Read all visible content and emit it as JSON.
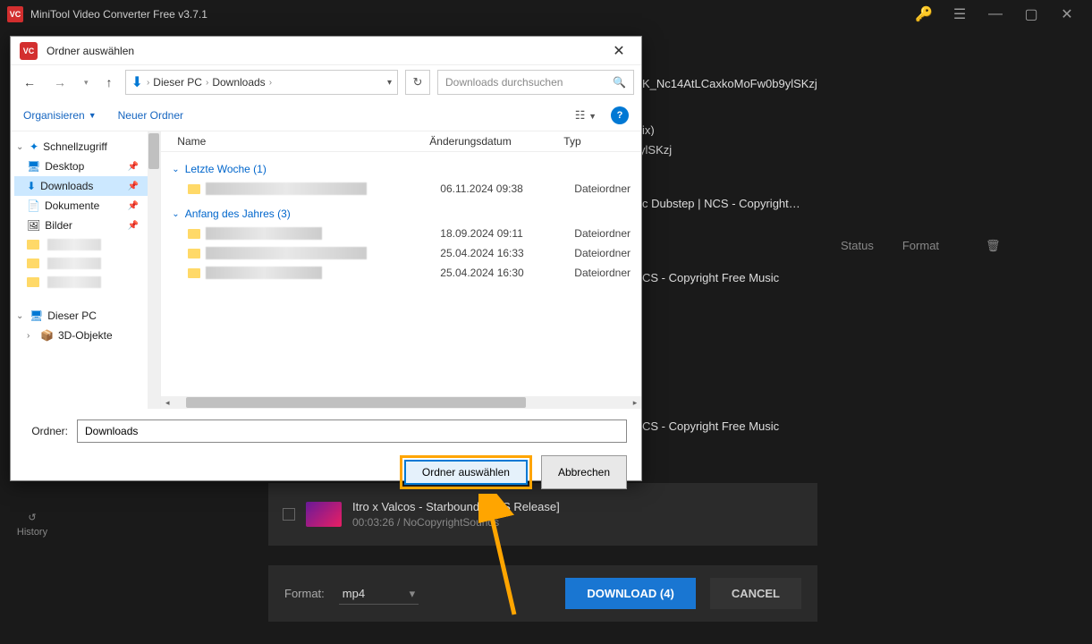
{
  "app": {
    "title": "MiniTool Video Converter Free v3.7.1",
    "logo_text": "VC"
  },
  "history_label": "History",
  "url_display": "Fw0b9ylSKzj",
  "url_truncated": "K_Nc14AtLCaxkoMoFw0b9ylSKzj",
  "playlist_frag": "ix)",
  "videos": [
    {
      "title_frag": "c Dubstep | NCS - Copyright…"
    },
    {
      "title_frag": "CS - Copyright Free Music"
    },
    {
      "title_frag": "CS - Copyright Free Music"
    },
    {
      "title": "Itro x Valcos - Starbound [NCS Release]",
      "meta": "00:03:26 / NoCopyrightSounds"
    }
  ],
  "headers": {
    "status": "Status",
    "format": "Format"
  },
  "format": {
    "label": "Format:",
    "value": "mp4"
  },
  "buttons": {
    "download": "DOWNLOAD (4)",
    "cancel": "CANCEL"
  },
  "dialog": {
    "title": "Ordner auswählen",
    "breadcrumb": [
      "Dieser PC",
      "Downloads"
    ],
    "search_placeholder": "Downloads durchsuchen",
    "organize": "Organisieren",
    "new_folder": "Neuer Ordner",
    "tree": {
      "quick": "Schnellzugriff",
      "desktop": "Desktop",
      "downloads": "Downloads",
      "documents": "Dokumente",
      "pictures": "Bilder",
      "this_pc": "Dieser PC",
      "objects3d": "3D-Objekte"
    },
    "columns": {
      "name": "Name",
      "date": "Änderungsdatum",
      "type": "Typ"
    },
    "groups": [
      {
        "label": "Letzte Woche (1)",
        "rows": [
          {
            "date": "06.11.2024 09:38",
            "type": "Dateiordner"
          }
        ]
      },
      {
        "label": "Anfang des Jahres (3)",
        "rows": [
          {
            "date": "18.09.2024 09:11",
            "type": "Dateiordner"
          },
          {
            "date": "25.04.2024 16:33",
            "type": "Dateiordner"
          },
          {
            "date": "25.04.2024 16:30",
            "type": "Dateiordner"
          }
        ]
      }
    ],
    "folder_label": "Ordner:",
    "folder_value": "Downloads",
    "select_btn": "Ordner auswählen",
    "cancel_btn": "Abbrechen"
  }
}
